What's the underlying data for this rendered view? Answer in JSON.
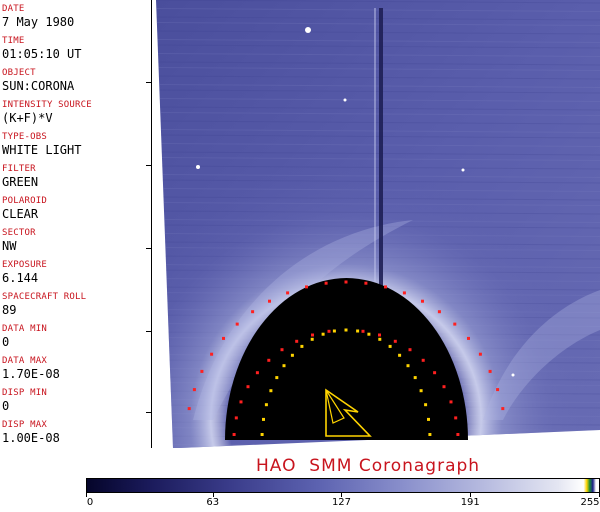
{
  "metadata": [
    {
      "label": "DATE",
      "value": "7 May 1980"
    },
    {
      "label": "TIME",
      "value": "01:05:10 UT"
    },
    {
      "label": "OBJECT",
      "value": "SUN:CORONA"
    },
    {
      "label": "INTENSITY SOURCE",
      "value": "(K+F)*V"
    },
    {
      "label": "TYPE-OBS",
      "value": "WHITE LIGHT"
    },
    {
      "label": "FILTER",
      "value": "GREEN"
    },
    {
      "label": "POLAROID",
      "value": "CLEAR"
    },
    {
      "label": "SECTOR",
      "value": "NW"
    },
    {
      "label": "EXPOSURE",
      "value": "6.144"
    },
    {
      "label": "SPACECRAFT ROLL",
      "value": "89"
    },
    {
      "label": "DATA MIN",
      "value": "0"
    },
    {
      "label": "DATA MAX",
      "value": "1.70E-08"
    },
    {
      "label": "DISP MIN",
      "value": "0"
    },
    {
      "label": "DISP MAX",
      "value": "1.00E-08"
    }
  ],
  "caption": "HAO  SMM Coronagraph",
  "colorbar": {
    "ticks": [
      "0",
      "63",
      "127",
      "191",
      "255"
    ],
    "tick_values": [
      0,
      63,
      127,
      191,
      255
    ],
    "max": 255
  },
  "colors": {
    "label_red": "#c8141e",
    "corona_blue": "#5a5ea8",
    "occulter": "#000000",
    "marker_red": "#ff2020",
    "marker_yellow": "#ffd400"
  }
}
